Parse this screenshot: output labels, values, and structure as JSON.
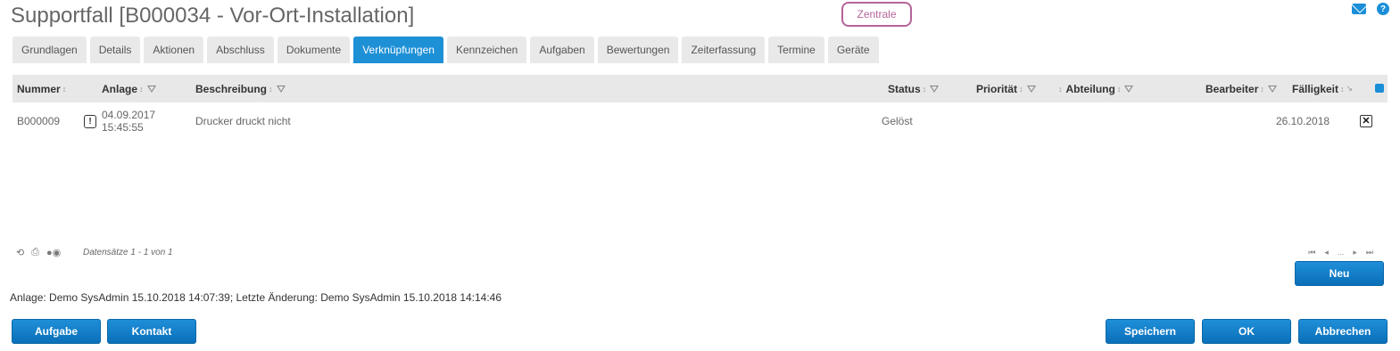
{
  "header": {
    "title": "Supportfall [B000034 - Vor-Ort-Installation]",
    "badge": "Zentrale",
    "help_glyph": "?"
  },
  "tabs": [
    {
      "label": "Grundlagen"
    },
    {
      "label": "Details"
    },
    {
      "label": "Aktionen"
    },
    {
      "label": "Abschluss"
    },
    {
      "label": "Dokumente"
    },
    {
      "label": "Verknüpfungen",
      "active": true
    },
    {
      "label": "Kennzeichen"
    },
    {
      "label": "Aufgaben"
    },
    {
      "label": "Bewertungen"
    },
    {
      "label": "Zeiterfassung"
    },
    {
      "label": "Termine"
    },
    {
      "label": "Geräte"
    }
  ],
  "grid": {
    "columns": {
      "nummer": "Nummer",
      "anlage": "Anlage",
      "beschreibung": "Beschreibung",
      "status": "Status",
      "prioritaet": "Priorität",
      "abteilung": "Abteilung",
      "bearbeiter": "Bearbeiter",
      "faelligkeit": "Fälligkeit"
    },
    "rows": [
      {
        "nummer": "B000009",
        "priority_glyph": "!",
        "anlage_date": "04.09.2017",
        "anlage_time": "15:45:55",
        "beschreibung": "Drucker druckt nicht",
        "status": "Gelöst",
        "faelligkeit": "26.10.2018",
        "delete_glyph": "✕"
      }
    ],
    "records_label": "Datensätze 1 - 1 von 1",
    "pager": {
      "first": "⏮",
      "prev": "◂",
      "ellipsis": "...",
      "next": "▸",
      "last": "⏭"
    }
  },
  "buttons": {
    "neu": "Neu",
    "aufgabe": "Aufgabe",
    "kontakt": "Kontakt",
    "speichern": "Speichern",
    "ok": "OK",
    "abbrechen": "Abbrechen"
  },
  "audit": "Anlage: Demo SysAdmin 15.10.2018 14:07:39; Letzte Änderung: Demo SysAdmin 15.10.2018 14:14:46",
  "colors": {
    "accent": "#1e90d6",
    "badge": "#b5649a"
  }
}
